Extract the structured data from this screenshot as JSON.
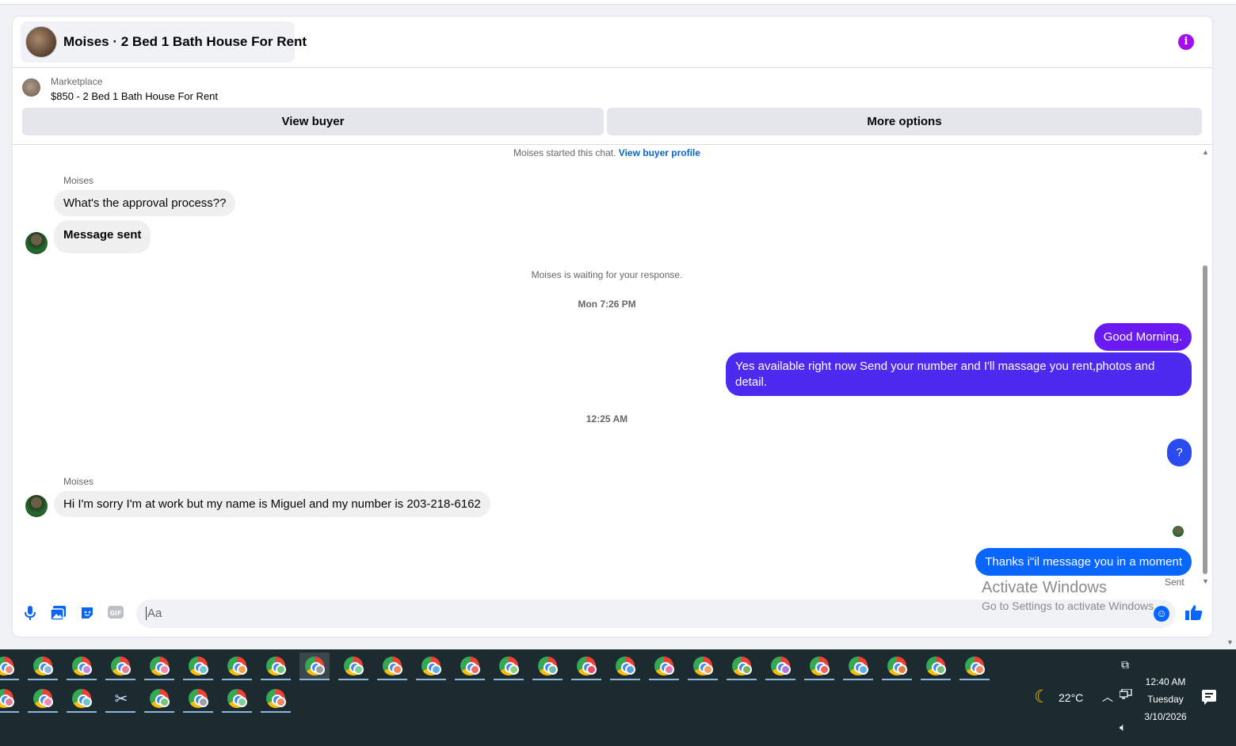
{
  "header": {
    "title": "Moises · 2 Bed 1 Bath House For Rent",
    "info_icon": "info-icon"
  },
  "marketplace": {
    "label": "Marketplace",
    "listing": "$850 - 2 Bed 1 Bath House For Rent",
    "view_buyer": "View buyer",
    "more_options": "More options"
  },
  "chat": {
    "started_text": "Moises started this chat.",
    "view_buyer_profile": "View buyer profile",
    "waiting_text": "Moises is waiting for your response.",
    "timestamp_1": "Mon 7:26 PM",
    "timestamp_2": "12:25 AM",
    "messages": [
      {
        "sender": "Moises",
        "text": "What's the approval process??"
      },
      {
        "text": "Message sent"
      },
      {
        "text": "Good Morning."
      },
      {
        "text": "Yes available right now Send your number and I'll massage you rent,photos and detail."
      },
      {
        "text": "?"
      },
      {
        "sender": "Moises",
        "text": "Hi I'm sorry I'm at work but my name is Miguel and my number is 203-218-6162"
      },
      {
        "text": "Thanks i\"il message you in a moment"
      }
    ],
    "sent_status": "Sent"
  },
  "composer": {
    "placeholder": "Aa",
    "icons": [
      "microphone-icon",
      "photo-icon",
      "sticker-icon",
      "gif-icon",
      "emoji-icon",
      "like-icon"
    ],
    "gif_label": "GIF"
  },
  "watermark": {
    "line1": "Activate Windows",
    "line2": "Go to Settings to activate Windows."
  },
  "taskbar": {
    "weather_temp": "22°C",
    "time": "12:40 AM",
    "day": "Tuesday",
    "date": "3/10/2026"
  },
  "colors": {
    "info": "#a40bf0",
    "bubble_purple": "#6a1bf2",
    "bubble_indigo": "#4d2af0",
    "bubble_blue": "#2b4af0",
    "bubble_light_blue": "#0866ff",
    "link": "#0a66c2",
    "taskbar": "#1c2b30"
  }
}
